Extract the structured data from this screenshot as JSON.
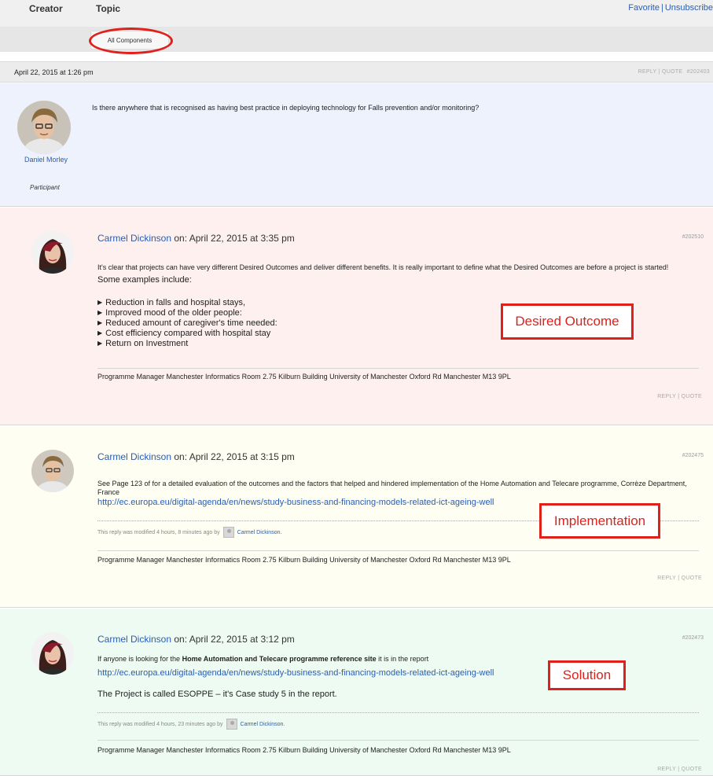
{
  "header": {
    "creator_label": "Creator",
    "topic_label": "Topic",
    "favorite_link": "Favorite",
    "separator": "|",
    "unsubscribe_link": "Unsubscribe"
  },
  "filter": {
    "selected_label": "All Components"
  },
  "topic": {
    "date": "April 22, 2015 at 1:26 pm",
    "actions": "REPLY | QUOTE",
    "id": "#202403",
    "author": "Daniel Morley",
    "role": "Participant",
    "text": "Is there anywhere that is recognised as having best practice in deploying technology for Falls prevention and/or monitoring?"
  },
  "replies": [
    {
      "author": "Carmel Dickinson",
      "on_text": " on: April 22, 2015 at 3:35 pm",
      "id": "#202510",
      "line1": "It's clear that projects can have very different Desired Outcomes and deliver different benefits. It is really important to define what the Desired Outcomes are before a project is started!",
      "line2": "Some examples include:",
      "bullets": [
        "Reduction in falls and hospital stays,",
        "Improved mood of the older people:",
        "Reduced amount of caregiver's time needed:",
        "Cost efficiency compared with hospital stay",
        "Return on Investment"
      ],
      "signature": "Programme Manager Manchester Informatics Room 2.75 Kilburn Building University of Manchester Oxford Rd Manchester M13 9PL",
      "actions": "REPLY | QUOTE"
    },
    {
      "author": "Carmel Dickinson",
      "on_text": " on: April 22, 2015 at 3:15 pm",
      "id": "#202475",
      "line1": "See Page 123 of for a detailed evaluation of the outcomes and the factors that helped and hindered implementation of the Home Automation and Telecare programme, Corrèze Department,",
      "line2": "France",
      "link": "http://ec.europa.eu/digital-agenda/en/news/study-business-and-financing-models-related-ict-ageing-well",
      "modified_text": "This reply was modified 4 hours, 8 minutes ago by",
      "modified_by": "Carmel Dickinson.",
      "signature": "Programme Manager Manchester Informatics Room 2.75 Kilburn Building University of Manchester Oxford Rd Manchester M13 9PL",
      "actions": "REPLY | QUOTE"
    },
    {
      "author": "Carmel Dickinson",
      "on_text": " on: April 22, 2015 at 3:12 pm",
      "id": "#202473",
      "line1_pre": "If anyone is looking for the ",
      "line1_bold": "Home Automation and Telecare programme reference site",
      "line1_post": " it is in the report",
      "link": "http://ec.europa.eu/digital-agenda/en/news/study-business-and-financing-models-related-ict-ageing-well",
      "line2": "The Project is called ESOPPE – it's Case study 5 in the report.",
      "modified_text": "This reply was modified 4 hours, 23 minutes ago by",
      "modified_by": "Carmel Dickinson.",
      "signature": "Programme Manager Manchester Informatics Room 2.75 Kilburn Building University of Manchester Oxford Rd Manchester M13 9PL",
      "actions": "REPLY | QUOTE"
    }
  ],
  "annotations": {
    "desired": "Desired Outcome",
    "implementation": "Implementation",
    "solution": "Solution"
  },
  "colors": {
    "link": "#2a5db0",
    "annotation": "#e0201b"
  }
}
